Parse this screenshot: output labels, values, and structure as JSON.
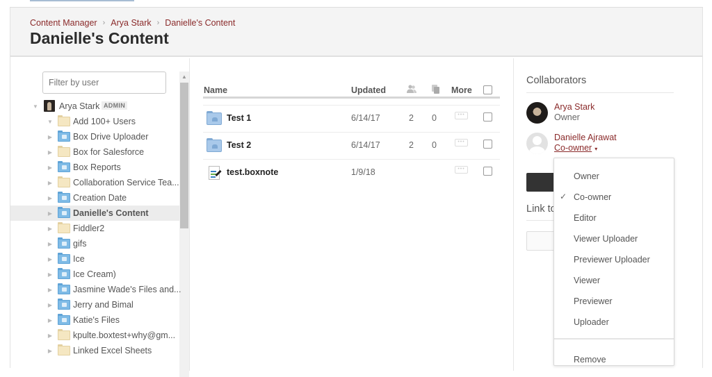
{
  "header": {
    "breadcrumb": [
      "Content Manager",
      "Arya Stark",
      "Danielle's Content"
    ],
    "breadcrumb_separator": "›",
    "title": "Danielle's Content"
  },
  "sidebar": {
    "filter_placeholder": "Filter by user",
    "root": {
      "label": "Arya Stark",
      "badge": "ADMIN",
      "expanded": true
    },
    "items": [
      {
        "label": "Add 100+ Users",
        "icon": "folder-plain",
        "expanded": true,
        "selected": false
      },
      {
        "label": "Box Drive Uploader",
        "icon": "folder-shared",
        "expanded": false,
        "selected": false
      },
      {
        "label": "Box for Salesforce",
        "icon": "folder-plain",
        "expanded": false,
        "selected": false
      },
      {
        "label": "Box Reports",
        "icon": "folder-shared",
        "expanded": false,
        "selected": false
      },
      {
        "label": "Collaboration Service Tea...",
        "icon": "folder-plain",
        "expanded": false,
        "selected": false
      },
      {
        "label": "Creation Date",
        "icon": "folder-shared",
        "expanded": false,
        "selected": false
      },
      {
        "label": "Danielle's Content",
        "icon": "folder-shared",
        "expanded": false,
        "selected": true
      },
      {
        "label": "Fiddler2",
        "icon": "folder-plain",
        "expanded": false,
        "selected": false
      },
      {
        "label": "gifs",
        "icon": "folder-shared",
        "expanded": false,
        "selected": false
      },
      {
        "label": "Ice",
        "icon": "folder-shared",
        "expanded": false,
        "selected": false
      },
      {
        "label": "Ice Cream)",
        "icon": "folder-shared",
        "expanded": false,
        "selected": false
      },
      {
        "label": "Jasmine Wade's Files and...",
        "icon": "folder-shared",
        "expanded": false,
        "selected": false
      },
      {
        "label": "Jerry and Bimal",
        "icon": "folder-shared",
        "expanded": false,
        "selected": false
      },
      {
        "label": "Katie's Files",
        "icon": "folder-shared",
        "expanded": false,
        "selected": false
      },
      {
        "label": "kpulte.boxtest+why@gm...",
        "icon": "folder-plain",
        "expanded": false,
        "selected": false
      },
      {
        "label": "Linked Excel Sheets",
        "icon": "folder-plain",
        "expanded": false,
        "selected": false
      }
    ]
  },
  "table": {
    "columns": {
      "name": "Name",
      "updated": "Updated",
      "collaborators_icon": "collaborators-icon",
      "files_icon": "files-icon",
      "more": "More"
    },
    "rows": [
      {
        "name": "Test 1",
        "type": "shared-folder",
        "updated": "6/14/17",
        "collaborators": "2",
        "files": "0"
      },
      {
        "name": "Test 2",
        "type": "shared-folder",
        "updated": "6/14/17",
        "collaborators": "2",
        "files": "0"
      },
      {
        "name": "test.boxnote",
        "type": "boxnote",
        "updated": "1/9/18",
        "collaborators": "",
        "files": ""
      }
    ],
    "more_glyph": "•••"
  },
  "collaborators": {
    "title": "Collaborators",
    "list": [
      {
        "name": "Arya Stark",
        "role": "Owner",
        "editable": false
      },
      {
        "name": "Danielle Ajrawat",
        "role": "Co-owner",
        "editable": true
      }
    ],
    "link_title": "Link to"
  },
  "role_menu": {
    "selected": "Co-owner",
    "items": [
      "Owner",
      "Co-owner",
      "Editor",
      "Viewer Uploader",
      "Previewer Uploader",
      "Viewer",
      "Previewer",
      "Uploader"
    ],
    "remove_label": "Remove",
    "check_glyph": "✓",
    "caret_glyph": "▾"
  },
  "colors": {
    "link": "#8a2a2a",
    "header_bg": "#f4f4f4",
    "shared_folder": "#7fbbe6",
    "plain_folder": "#f5e7c2"
  }
}
